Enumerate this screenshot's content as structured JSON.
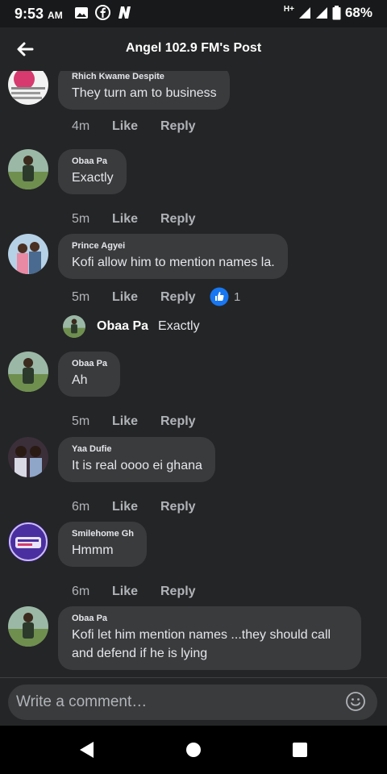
{
  "status_bar": {
    "time": "9:53",
    "ampm": "AM",
    "network": "H+",
    "battery": "68%"
  },
  "header": {
    "title": "Angel 102.9 FM's Post",
    "back_icon": "arrow-left-icon"
  },
  "comments": [
    {
      "author": "Rhich Kwame Despite",
      "text": "They turn am to business",
      "time": "4m",
      "like": "Like",
      "reply": "Reply"
    },
    {
      "author": "Obaa Pa",
      "text": "Exactly",
      "time": "5m",
      "like": "Like",
      "reply": "Reply"
    },
    {
      "author": "Prince Agyei",
      "text": "Kofi allow him to mention names la.",
      "time": "5m",
      "like": "Like",
      "reply": "Reply",
      "reaction_count": "1"
    },
    {
      "author": "Obaa Pa",
      "text": "Ah",
      "time": "5m",
      "like": "Like",
      "reply": "Reply"
    },
    {
      "author": "Yaa Dufie",
      "text": "It is real oooo ei ghana",
      "time": "6m",
      "like": "Like",
      "reply": "Reply"
    },
    {
      "author": "Smilehome Gh",
      "text": "Hmmm",
      "time": "6m",
      "like": "Like",
      "reply": "Reply"
    },
    {
      "author": "Obaa Pa",
      "text_line1": "Kofi let him mention names ...they should call",
      "text_line2": "and defend if he is lying"
    }
  ],
  "reply_preview": {
    "author": "Obaa Pa",
    "text": "Exactly"
  },
  "composer": {
    "placeholder": "Write a comment…"
  },
  "colors": {
    "background": "#242526",
    "bubble": "#3a3b3c",
    "like_blue": "#1877f2"
  }
}
